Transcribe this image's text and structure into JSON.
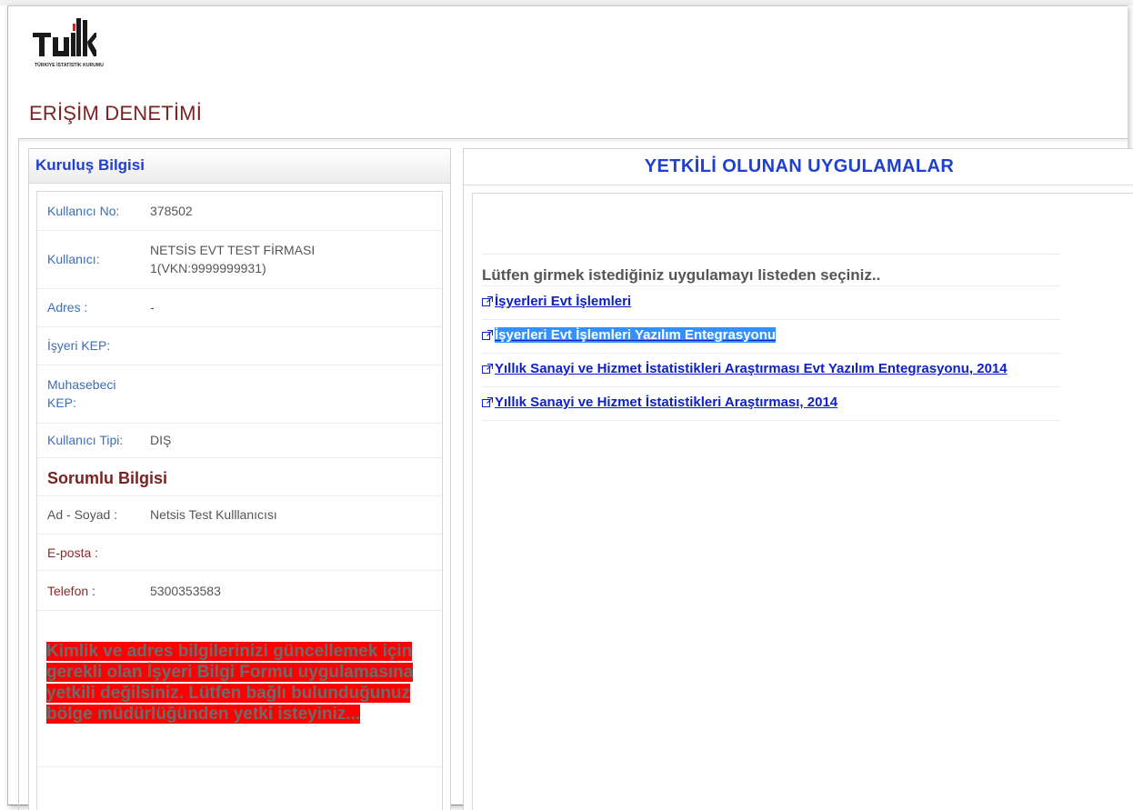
{
  "brand": {
    "logo_text": "TÜİK",
    "logo_subtext": "TÜRKİYE İSTATİSTİK KURUMU",
    "colors": {
      "dark": "#1a1a1a",
      "red": "#c0282d"
    }
  },
  "page": {
    "title": "ERİŞİM DENETİMİ"
  },
  "left_panel": {
    "header": "Kuruluş Bilgisi",
    "org_rows": [
      {
        "label": "Kullanıcı No:",
        "value": "378502"
      },
      {
        "label": "Kullanıcı:",
        "value": "NETSİS EVT TEST FİRMASI 1(VKN:9999999931)"
      },
      {
        "label": "Adres :",
        "value": "-"
      },
      {
        "label": "İşyeri KEP:",
        "value": ""
      },
      {
        "label": "Muhasebeci KEP:",
        "value": ""
      },
      {
        "label": "Kullanıcı Tipi:",
        "value": "DIŞ"
      }
    ],
    "responsible_title": "Sorumlu Bilgisi",
    "responsible_rows": [
      {
        "label": "Ad - Soyad :",
        "value": "Netsis Test Kulllanıcısı"
      },
      {
        "label": "E-posta :",
        "value": ""
      },
      {
        "label": "Telefon :",
        "value": "5300353583"
      }
    ],
    "warning": "Kimlik ve adres bilgilerinizi güncellemek için gerekli olan İşyeri Bilgi Formu uygulamasına yetkili değilsiniz. Lütfen bağlı bulunduğunuz bölge müdürlüğünden yetki isteyiniz..."
  },
  "right_panel": {
    "header": "YETKİLİ OLUNAN UYGULAMALAR",
    "prompt": "Lütfen girmek istediğiniz uygulamayı listeden seçiniz..",
    "apps": [
      {
        "label": "İşyerleri Evt İşlemleri",
        "icon": "external-link-icon"
      },
      {
        "label": "İşyerleri Evt İşlemleri Yazılım Entegrasyonu",
        "icon": "external-link-icon",
        "selected": true
      },
      {
        "label": "Yıllık Sanayi ve Hizmet İstatistikleri Araştırması Evt Yazılım Entegrasyonu, 2014",
        "icon": "external-link-icon"
      },
      {
        "label": "Yıllık Sanayi ve Hizmet İstatistikleri Araştırması, 2014",
        "icon": "external-link-icon"
      }
    ]
  }
}
